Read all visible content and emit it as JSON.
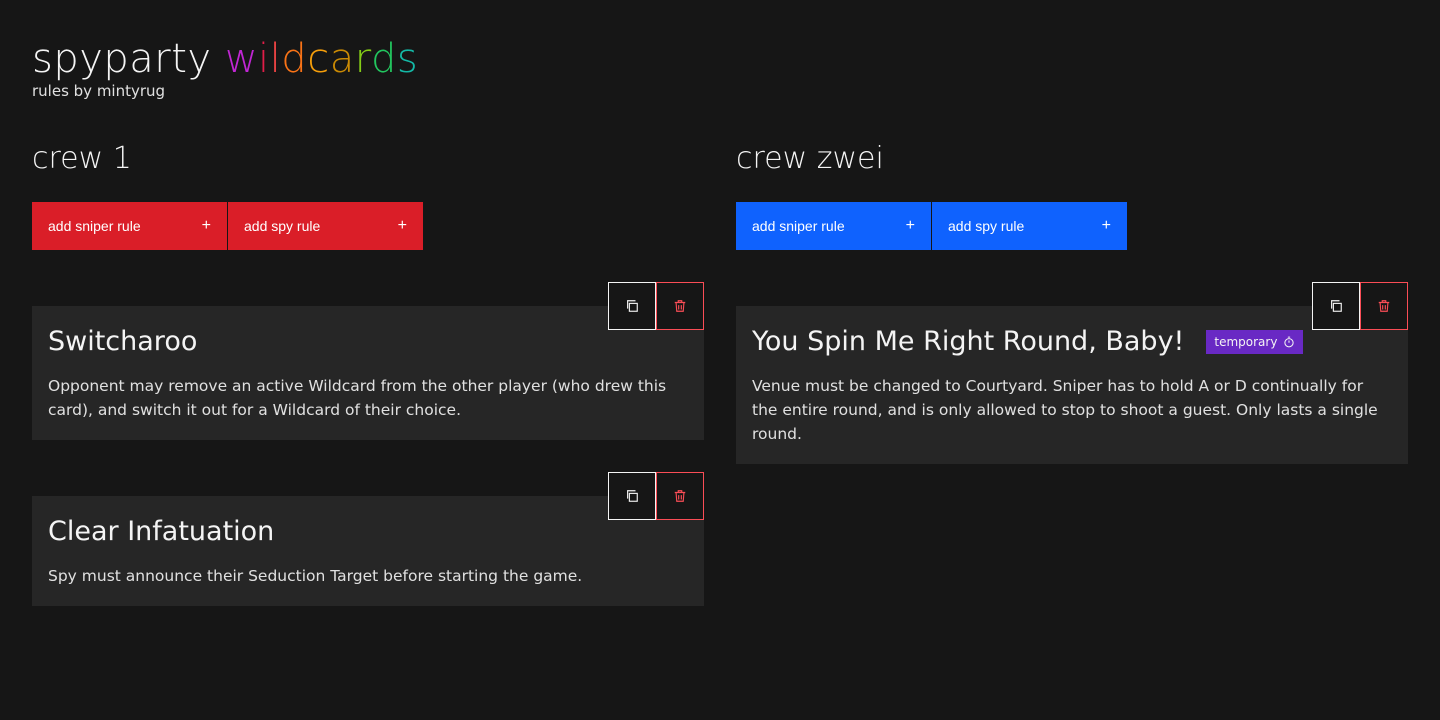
{
  "app": {
    "title_plain": "spyparty",
    "title_colored": [
      "w",
      "i",
      "l",
      "d",
      "c",
      "a",
      "r",
      "d",
      "s"
    ],
    "title_colors": [
      "#c026d3",
      "#e11d48",
      "#ef4444",
      "#f97316",
      "#f59e0b",
      "#ca8a04",
      "#84cc16",
      "#22c55e",
      "#14b8a6"
    ],
    "subtitle": "rules by mintyrug"
  },
  "crews": [
    {
      "name": "crew 1",
      "accent": "#da1e28",
      "buttons": {
        "sniper": "add sniper rule",
        "spy": "add spy rule",
        "plus": "+"
      },
      "cards": [
        {
          "title": "Switcharoo",
          "description": "Opponent may remove an active Wildcard from the other player (who drew this card), and switch it out for a Wildcard of their choice."
        },
        {
          "title": "Clear Infatuation",
          "description": "Spy must announce their Seduction Target before starting the game."
        }
      ]
    },
    {
      "name": "crew zwei",
      "accent": "#0f62fe",
      "buttons": {
        "sniper": "add sniper rule",
        "spy": "add spy rule",
        "plus": "+"
      },
      "cards": [
        {
          "title": "You Spin Me Right Round, Baby!",
          "tag": "temporary",
          "tag_color": "#6929c4",
          "description": "Venue must be changed to Courtyard. Sniper has to hold A or D continually for the entire round, and is only allowed to stop to shoot a guest. Only lasts a single round."
        }
      ]
    }
  ],
  "icons": {
    "copy": "copy-icon",
    "delete": "trash-icon",
    "timer": "timer-icon"
  }
}
